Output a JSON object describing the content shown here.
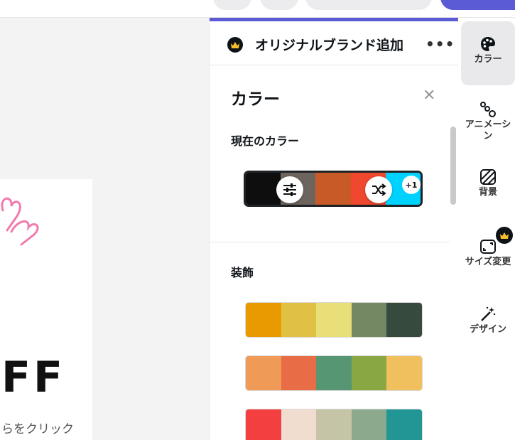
{
  "brand": {
    "title": "オリジナルブランド追加",
    "more": "•••"
  },
  "panel": {
    "title": "カラー",
    "close": "✕"
  },
  "current": {
    "title": "現在のカラー",
    "swatches": [
      "#0e0e0e",
      "#6d655d",
      "#c85a28",
      "#f0482f",
      "#00d2ff"
    ],
    "more_count": "+1"
  },
  "decor": {
    "title": "装飾",
    "palettes": [
      [
        "#e99a00",
        "#e1c144",
        "#e8df78",
        "#758864",
        "#364a3e"
      ],
      [
        "#ef9b57",
        "#e86c45",
        "#569672",
        "#89a843",
        "#f0c05e"
      ],
      [
        "#f33f3f",
        "#f0ddd0",
        "#c6c4a7",
        "#8ca98d",
        "#219695"
      ]
    ]
  },
  "canvas": {
    "big_text": "FF",
    "sub_text": "らをクリック"
  },
  "rail": [
    {
      "label": "カラー",
      "icon": "palette-icon"
    },
    {
      "label": "アニメーシ",
      "label2": "ン",
      "icon": "animation-icon"
    },
    {
      "label": "背景",
      "icon": "background-icon"
    },
    {
      "label": "サイズ変更",
      "icon": "resize-icon"
    },
    {
      "label": "デザイン",
      "icon": "magic-wand-icon"
    }
  ]
}
